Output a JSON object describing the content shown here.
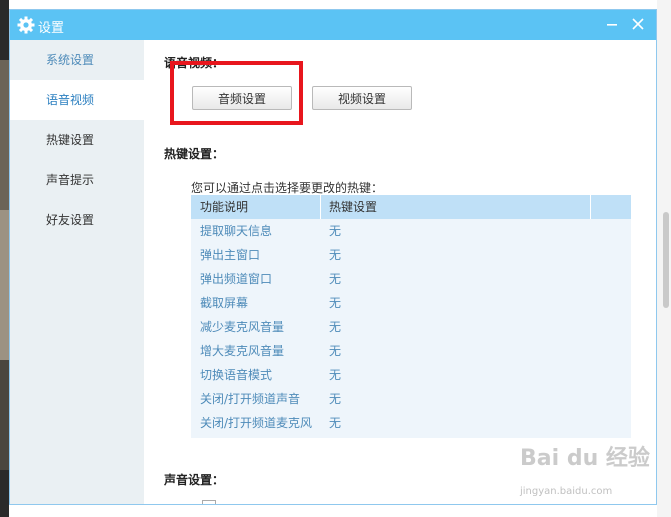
{
  "window": {
    "title": "设置"
  },
  "sidebar": {
    "items": [
      {
        "label": "系统设置"
      },
      {
        "label": "语音视频"
      },
      {
        "label": "热键设置"
      },
      {
        "label": "声音提示"
      },
      {
        "label": "好友设置"
      }
    ]
  },
  "audio_video": {
    "title": "语音视频：",
    "audio_button": "音频设置",
    "video_button": "视频设置"
  },
  "hotkeys": {
    "title": "热键设置：",
    "hint": "您可以通过点击选择要更改的热键：",
    "columns": [
      "功能说明",
      "热键设置"
    ],
    "rows": [
      {
        "func": "提取聊天信息",
        "key": "无"
      },
      {
        "func": "弹出主窗口",
        "key": "无"
      },
      {
        "func": "弹出频道窗口",
        "key": "无"
      },
      {
        "func": "截取屏幕",
        "key": "无"
      },
      {
        "func": "减少麦克风音量",
        "key": "无"
      },
      {
        "func": "增大麦克风音量",
        "key": "无"
      },
      {
        "func": "切换语音模式",
        "key": "无"
      },
      {
        "func": "关闭/打开频道声音",
        "key": "无"
      },
      {
        "func": "关闭/打开频道麦克风",
        "key": "无"
      }
    ]
  },
  "sound": {
    "title": "声音设置："
  },
  "watermark": {
    "brand": "Bai du 经验",
    "site": "jingyan.baidu.com"
  },
  "colors": {
    "titlebar": "#5bc3f4",
    "sidebar": "#eaf0f3",
    "table_header": "#bfe0f7",
    "highlight_box": "#e8161d",
    "link_text": "#4e8bb9"
  },
  "icons": {
    "title": "gear-icon",
    "minimize": "minimize-icon",
    "close": "close-icon"
  }
}
